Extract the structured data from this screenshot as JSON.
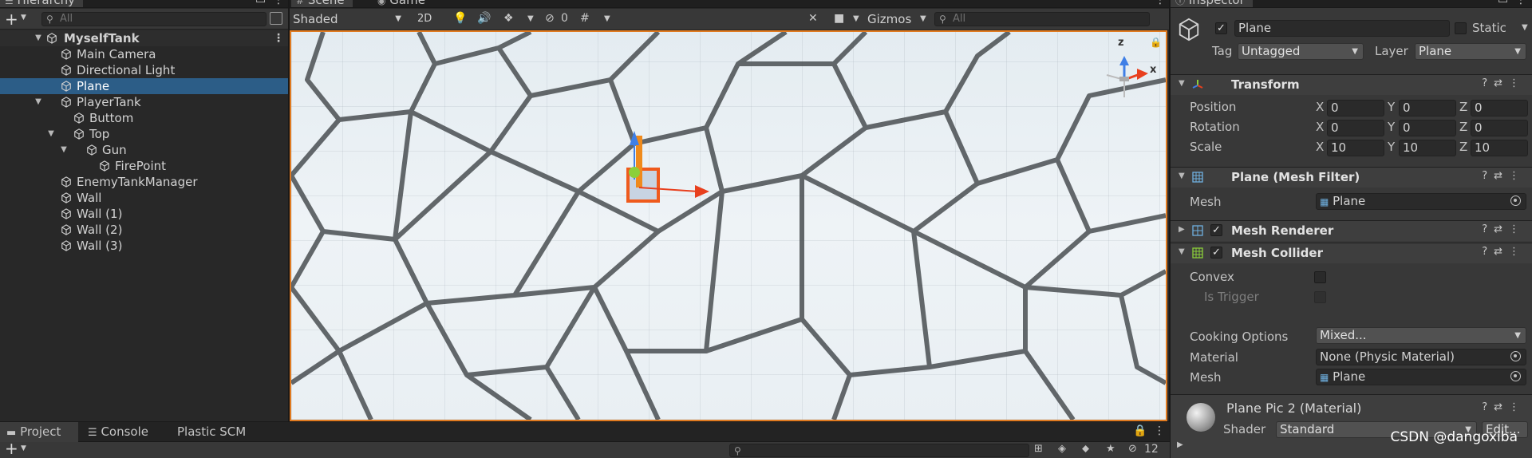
{
  "hierarchy": {
    "tab_label": "Hierarchy",
    "search_placeholder": "All",
    "scene_name": "MyselfTank",
    "items": [
      {
        "label": "Main Camera",
        "depth": 1,
        "expandable": false
      },
      {
        "label": "Directional Light",
        "depth": 1,
        "expandable": false
      },
      {
        "label": "Plane",
        "depth": 1,
        "expandable": false,
        "selected": true
      },
      {
        "label": "PlayerTank",
        "depth": 1,
        "expandable": true
      },
      {
        "label": "Buttom",
        "depth": 2,
        "expandable": false
      },
      {
        "label": "Top",
        "depth": 2,
        "expandable": true
      },
      {
        "label": "Gun",
        "depth": 3,
        "expandable": true
      },
      {
        "label": "FirePoint",
        "depth": 4,
        "expandable": false
      },
      {
        "label": "EnemyTankManager",
        "depth": 1,
        "expandable": false
      },
      {
        "label": "Wall",
        "depth": 1,
        "expandable": false
      },
      {
        "label": "Wall (1)",
        "depth": 1,
        "expandable": false
      },
      {
        "label": "Wall (2)",
        "depth": 1,
        "expandable": false
      },
      {
        "label": "Wall (3)",
        "depth": 1,
        "expandable": false
      }
    ]
  },
  "scene": {
    "tabs": [
      "Scene",
      "Game"
    ],
    "shading_mode": "Shaded",
    "mode_2d": "2D",
    "hidden_count": "0",
    "gizmos_label": "Gizmos",
    "search_placeholder": "All",
    "axis_labels": {
      "x": "x",
      "z": "z"
    }
  },
  "inspector": {
    "tab_label": "Inspector",
    "object_name": "Plane",
    "static_label": "Static",
    "tag_label": "Tag",
    "tag_value": "Untagged",
    "layer_label": "Layer",
    "layer_value": "Plane",
    "transform": {
      "title": "Transform",
      "rows": [
        {
          "label": "Position",
          "x": "0",
          "y": "0",
          "z": "0"
        },
        {
          "label": "Rotation",
          "x": "0",
          "y": "0",
          "z": "0"
        },
        {
          "label": "Scale",
          "x": "10",
          "y": "10",
          "z": "10"
        }
      ],
      "axis_x": "X",
      "axis_y": "Y",
      "axis_z": "Z"
    },
    "mesh_filter": {
      "title": "Plane (Mesh Filter)",
      "mesh_label": "Mesh",
      "mesh_value": "Plane"
    },
    "mesh_renderer": {
      "title": "Mesh Renderer"
    },
    "mesh_collider": {
      "title": "Mesh Collider",
      "convex_label": "Convex",
      "is_trigger_label": "Is Trigger",
      "cooking_label": "Cooking Options",
      "cooking_value": "Mixed...",
      "material_label": "Material",
      "material_value": "None (Physic Material)",
      "mesh_label": "Mesh",
      "mesh_value": "Plane"
    },
    "material": {
      "title": "Plane Pic 2 (Material)",
      "shader_label": "Shader",
      "shader_value": "Standard",
      "edit_label": "Edit..."
    }
  },
  "bottom": {
    "tabs": [
      "Project",
      "Console",
      "Plastic SCM"
    ],
    "hidden_packages_count": "12"
  },
  "watermark": "CSDN @dangoxiba",
  "colors": {
    "selection": "#2c5d87",
    "scene_border": "#e07b21",
    "gizmo_x": "#e8401e",
    "gizmo_y": "#8ccf3a",
    "gizmo_z": "#3f7fe6"
  }
}
